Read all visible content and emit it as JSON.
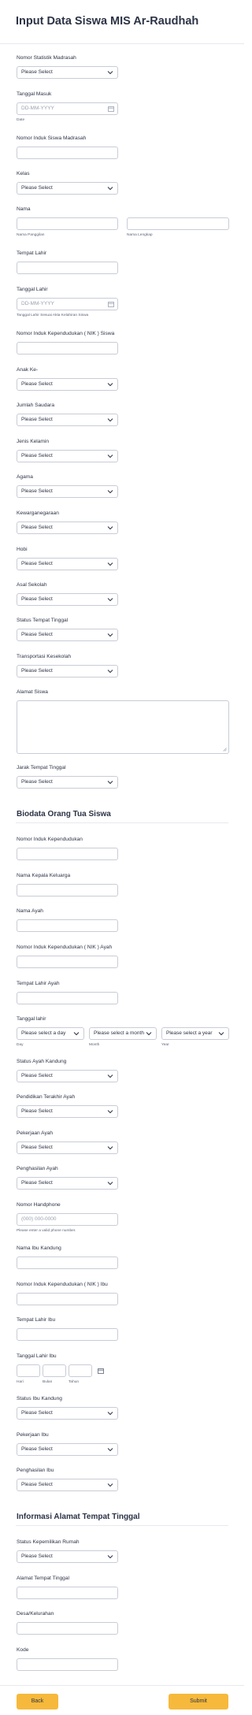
{
  "title": "Input Data Siswa MIS Ar-Raudhah",
  "placeholders": {
    "select": "Please Select",
    "date": "DD-MM-YYYY",
    "phone": "(000) 000-0000",
    "day": "Please select a day",
    "month": "Please select a month",
    "year": "Please select a year"
  },
  "sections": {
    "parents": "Biodata Orang Tua Siswa",
    "address": "Informasi Alamat Tempat Tinggal"
  },
  "fields": {
    "nsm": "Nomor Statistik Madrasah",
    "tanggal_masuk": "Tanggal Masuk",
    "tanggal_masuk_sub": "Date",
    "nism": "Nomor Induk Siswa Madrasah",
    "kelas": "Kelas",
    "nama": "Nama",
    "nama_panggilan": "Nama Panggilan",
    "nama_lengkap": "Nama Lengkap",
    "tempat_lahir": "Tempat Lahir",
    "tanggal_lahir": "Tanggal Lahir",
    "tanggal_lahir_sub": "Tanggal Lahir Sesuai Akta Kelahiran Siswa",
    "nik_siswa": "Nomor Induk Kependudukan ( NIK ) Siswa",
    "anak_ke": "Anak Ke-",
    "jumlah_saudara": "Jumlah Saudara",
    "jenis_kelamin": "Jenis Kelamin",
    "agama": "Agama",
    "kewarganegaraan": "Kewarganegaraan",
    "hobi": "Hobi",
    "asal_sekolah": "Asal Sekolah",
    "status_tempat_tinggal": "Status Tempat Tinggal",
    "transportasi": "Transportasi Kesekolah",
    "alamat_siswa": "Alamat Siswa",
    "jarak": "Jarak Tempat Tinggal",
    "nik": "Nomor Induk Kependudukan",
    "nama_kk": "Nama Kepala Keluarga",
    "nama_ayah": "Nama Ayah",
    "nik_ayah": "Nomor Induk Kependudukan ( NIK ) Ayah",
    "tempat_lahir_ayah": "Tempat Lahir Ayah",
    "tanggal_lahir_ayah": "Tanggal lahir",
    "day_sub": "Day",
    "month_sub": "Month",
    "year_sub": "Year",
    "status_ayah": "Status Ayah Kandung",
    "pendidikan_ayah": "Pendidikan Terakhir Ayah",
    "pekerjaan_ayah": "Pekerjaan Ayah",
    "penghasilan_ayah": "Penghasilan Ayah",
    "handphone": "Nomor Handphone",
    "handphone_sub": "Please enter a valid phone number.",
    "nama_ibu": "Nama Ibu Kandung",
    "nik_ibu": "Nomor Induk Kependudukan ( NIK ) Ibu",
    "tempat_lahir_ibu": "Tempat Lahir Ibu",
    "tanggal_lahir_ibu": "Tanggal Lahir Ibu",
    "hari_sub": "Hari",
    "bulan_sub": "Bulan",
    "tahun_sub": "Tahun",
    "status_ibu": "Status Ibu Kandung",
    "pekerjaan_ibu": "Pekerjaan Ibu",
    "penghasilan_ibu": "Penghasilan Ibu",
    "status_rumah": "Status Kepemilikan Rumah",
    "alamat_tempat_tinggal": "Alamat Tempat Tinggal",
    "desa": "Desa/Kelurahan",
    "kode": "Kode"
  },
  "buttons": {
    "back": "Back",
    "submit": "Submit"
  },
  "colors": {
    "accent": "#f6b93b",
    "border": "#c8ccd6",
    "text": "#2c3345"
  }
}
